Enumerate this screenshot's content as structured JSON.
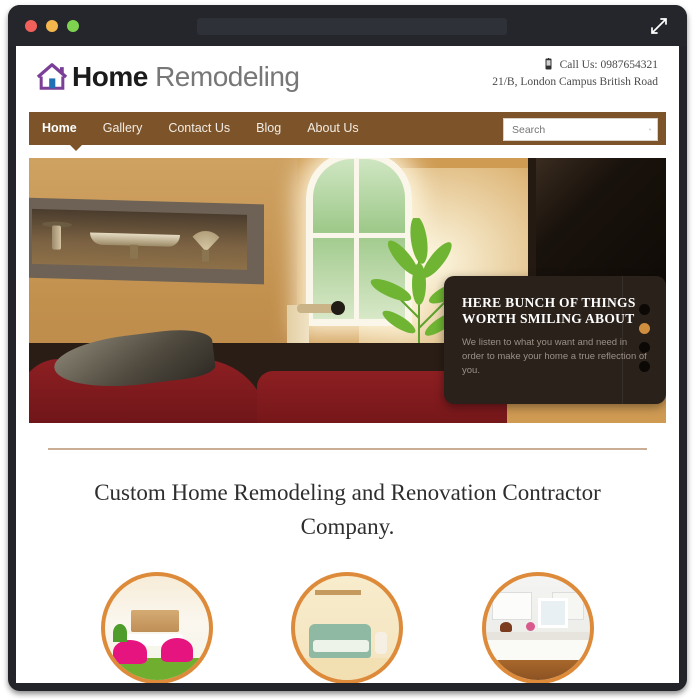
{
  "browser": {
    "traffic_lights": [
      "close",
      "minimize",
      "maximize"
    ],
    "address_value": "",
    "expand_icon": "expand-arrows-icon"
  },
  "site": {
    "logo": {
      "icon": "house-icon",
      "bold_text": "Home",
      "light_text": "Remodeling",
      "icon_color": "#7b3f98",
      "door_color": "#1f6fb5"
    },
    "contact": {
      "phone_icon": "mobile-phone-icon",
      "phone_line": "Call Us: 0987654321",
      "address_line": "21/B, London Campus British Road"
    },
    "nav": {
      "background": "#7d5429",
      "items": [
        {
          "label": "Home",
          "active": true
        },
        {
          "label": "Gallery",
          "active": false
        },
        {
          "label": "Contact Us",
          "active": false
        },
        {
          "label": "Blog",
          "active": false
        },
        {
          "label": "About Us",
          "active": false
        }
      ],
      "search": {
        "placeholder": "Search",
        "value": "",
        "icon": "search-icon"
      }
    },
    "hero": {
      "caption": {
        "title": "HERE BUNCH OF THINGS WORTH SMILING ABOUT",
        "body": "We listen to what you want and need in order to make your home a true reflection of you."
      },
      "slider": {
        "count": 4,
        "active_index": 1,
        "active_color": "#cf8f3e",
        "inactive_color": "#0b0805"
      }
    },
    "headline": "Custom Home Remodeling and Renovation Contractor Company.",
    "thumbnails": {
      "border_color": "#dd8b3a",
      "items": [
        {
          "name": "dining-room-thumbnail"
        },
        {
          "name": "living-room-thumbnail"
        },
        {
          "name": "kitchen-thumbnail"
        }
      ]
    }
  }
}
